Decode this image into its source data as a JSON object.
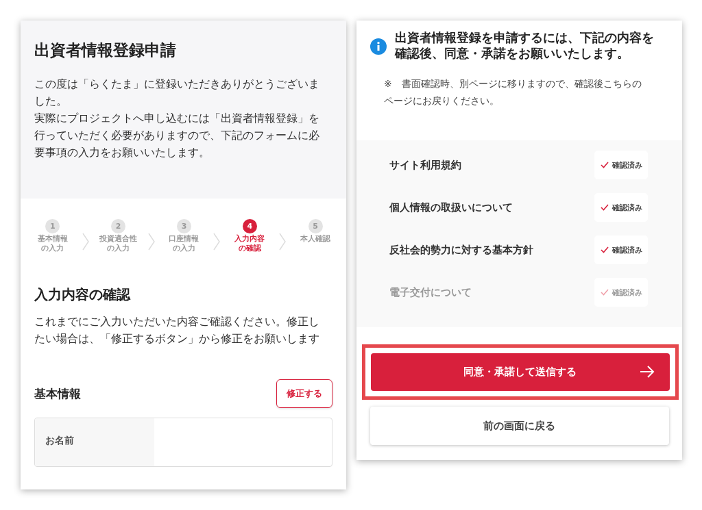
{
  "left_screen": {
    "title": "出資者情報登録申請",
    "intro": [
      "この度は「らくたま」に登録いただきありがとうございました。",
      "実際にプロジェクトへ申し込むには「出資者情報登録」を行っていただく必要がありますので、下記のフォームに必要事項の入力をお願いいたします。"
    ],
    "steps": [
      {
        "number": "1",
        "label_lines": [
          "基本情報",
          "の入力"
        ],
        "selected": false
      },
      {
        "number": "2",
        "label_lines": [
          "投資適合性",
          "の入力"
        ],
        "selected": false
      },
      {
        "number": "3",
        "label_lines": [
          "口座情報",
          "の入力"
        ],
        "selected": false
      },
      {
        "number": "4",
        "label_lines": [
          "入力内容",
          "の確認"
        ],
        "selected": true
      },
      {
        "number": "5",
        "label_lines": [
          "本人確認"
        ],
        "selected": false
      }
    ],
    "section_title": "入力内容の確認",
    "section_text": "これまでにご入力いただいた内容ご確認ください。修正したい場合は、「修正するボタン」から修正をお願いします",
    "group": {
      "title": "基本情報",
      "edit_button": "修正する",
      "rows": [
        {
          "label": "お名前"
        }
      ]
    }
  },
  "right_screen": {
    "info": "出資者情報登録を申請するには、下記の内容を確認後、同意・承諾をお願いいたします。",
    "note": "※　書面確認時、別ページに移りますので、確認後こちらのページにお戻りください。",
    "documents": [
      {
        "title": "サイト利用規約",
        "status": "確認済み",
        "disabled": false
      },
      {
        "title": "個人情報の取扱いについて",
        "status": "確認済み",
        "disabled": false
      },
      {
        "title": "反社会的勢力に対する基本方針",
        "status": "確認済み",
        "disabled": false
      },
      {
        "title": "電子交付について",
        "status": "確認済み",
        "disabled": true
      }
    ],
    "submit_button": "同意・承諾して送信する",
    "back_button": "前の画面に戻る"
  }
}
